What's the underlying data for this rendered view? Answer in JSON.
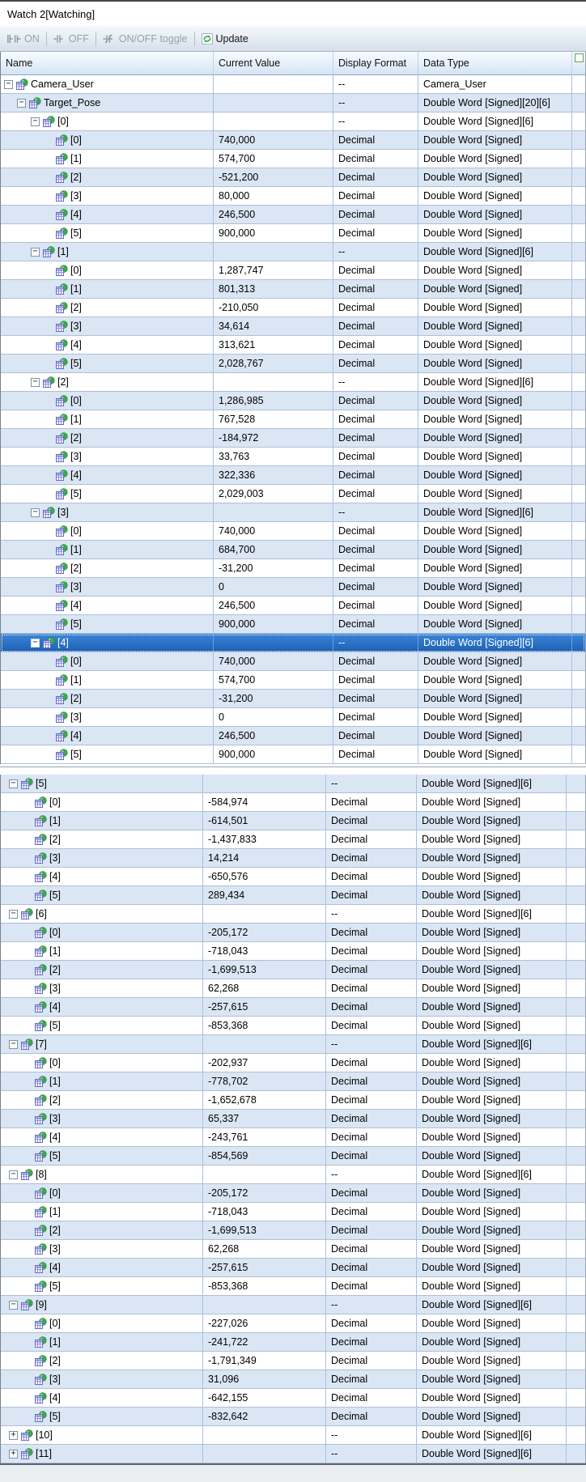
{
  "window": {
    "title": "Watch 2[Watching]"
  },
  "toolbar": {
    "items": [
      {
        "label": "ON",
        "icon": "contact-on-icon",
        "enabled": false
      },
      {
        "label": "OFF",
        "icon": "contact-off-icon",
        "enabled": false
      },
      {
        "label": "ON/OFF toggle",
        "icon": "contact-toggle-icon",
        "enabled": false
      },
      {
        "label": "Update",
        "icon": "refresh-icon",
        "enabled": true
      }
    ]
  },
  "columns": [
    "Name",
    "Current Value",
    "Display Format",
    "Data Type"
  ],
  "colors": {
    "selection_blue": "#2a6fc7",
    "row_alt_blue": "#dbe6f5",
    "grid_line_blue": "#a6c1e2",
    "refresh_green": "#2fa043"
  },
  "panes": [
    {
      "id": "top",
      "rows": [
        {
          "name": "Camera_User",
          "value": "",
          "format": "--",
          "dtype": "Camera_User",
          "indent": 0,
          "expander": "minus"
        },
        {
          "name": "Target_Pose",
          "value": "",
          "format": "--",
          "dtype": "Double Word [Signed][20][6]",
          "indent": 1,
          "expander": "minus"
        },
        {
          "name": "[0]",
          "value": "",
          "format": "--",
          "dtype": "Double Word [Signed][6]",
          "indent": 2,
          "expander": "minus"
        },
        {
          "name": "[0]",
          "value": "740,000",
          "format": "Decimal",
          "dtype": "Double Word [Signed]",
          "indent": 3
        },
        {
          "name": "[1]",
          "value": "574,700",
          "format": "Decimal",
          "dtype": "Double Word [Signed]",
          "indent": 3
        },
        {
          "name": "[2]",
          "value": "-521,200",
          "format": "Decimal",
          "dtype": "Double Word [Signed]",
          "indent": 3
        },
        {
          "name": "[3]",
          "value": "80,000",
          "format": "Decimal",
          "dtype": "Double Word [Signed]",
          "indent": 3
        },
        {
          "name": "[4]",
          "value": "246,500",
          "format": "Decimal",
          "dtype": "Double Word [Signed]",
          "indent": 3
        },
        {
          "name": "[5]",
          "value": "900,000",
          "format": "Decimal",
          "dtype": "Double Word [Signed]",
          "indent": 3
        },
        {
          "name": "[1]",
          "value": "",
          "format": "--",
          "dtype": "Double Word [Signed][6]",
          "indent": 2,
          "expander": "minus"
        },
        {
          "name": "[0]",
          "value": "1,287,747",
          "format": "Decimal",
          "dtype": "Double Word [Signed]",
          "indent": 3
        },
        {
          "name": "[1]",
          "value": "801,313",
          "format": "Decimal",
          "dtype": "Double Word [Signed]",
          "indent": 3
        },
        {
          "name": "[2]",
          "value": "-210,050",
          "format": "Decimal",
          "dtype": "Double Word [Signed]",
          "indent": 3
        },
        {
          "name": "[3]",
          "value": "34,614",
          "format": "Decimal",
          "dtype": "Double Word [Signed]",
          "indent": 3
        },
        {
          "name": "[4]",
          "value": "313,621",
          "format": "Decimal",
          "dtype": "Double Word [Signed]",
          "indent": 3
        },
        {
          "name": "[5]",
          "value": "2,028,767",
          "format": "Decimal",
          "dtype": "Double Word [Signed]",
          "indent": 3
        },
        {
          "name": "[2]",
          "value": "",
          "format": "--",
          "dtype": "Double Word [Signed][6]",
          "indent": 2,
          "expander": "minus"
        },
        {
          "name": "[0]",
          "value": "1,286,985",
          "format": "Decimal",
          "dtype": "Double Word [Signed]",
          "indent": 3
        },
        {
          "name": "[1]",
          "value": "767,528",
          "format": "Decimal",
          "dtype": "Double Word [Signed]",
          "indent": 3
        },
        {
          "name": "[2]",
          "value": "-184,972",
          "format": "Decimal",
          "dtype": "Double Word [Signed]",
          "indent": 3
        },
        {
          "name": "[3]",
          "value": "33,763",
          "format": "Decimal",
          "dtype": "Double Word [Signed]",
          "indent": 3
        },
        {
          "name": "[4]",
          "value": "322,336",
          "format": "Decimal",
          "dtype": "Double Word [Signed]",
          "indent": 3
        },
        {
          "name": "[5]",
          "value": "2,029,003",
          "format": "Decimal",
          "dtype": "Double Word [Signed]",
          "indent": 3
        },
        {
          "name": "[3]",
          "value": "",
          "format": "--",
          "dtype": "Double Word [Signed][6]",
          "indent": 2,
          "expander": "minus"
        },
        {
          "name": "[0]",
          "value": "740,000",
          "format": "Decimal",
          "dtype": "Double Word [Signed]",
          "indent": 3
        },
        {
          "name": "[1]",
          "value": "684,700",
          "format": "Decimal",
          "dtype": "Double Word [Signed]",
          "indent": 3
        },
        {
          "name": "[2]",
          "value": "-31,200",
          "format": "Decimal",
          "dtype": "Double Word [Signed]",
          "indent": 3
        },
        {
          "name": "[3]",
          "value": "0",
          "format": "Decimal",
          "dtype": "Double Word [Signed]",
          "indent": 3
        },
        {
          "name": "[4]",
          "value": "246,500",
          "format": "Decimal",
          "dtype": "Double Word [Signed]",
          "indent": 3
        },
        {
          "name": "[5]",
          "value": "900,000",
          "format": "Decimal",
          "dtype": "Double Word [Signed]",
          "indent": 3
        },
        {
          "name": "[4]",
          "value": "",
          "format": "--",
          "dtype": "Double Word [Signed][6]",
          "indent": 2,
          "expander": "minus",
          "selected": true
        },
        {
          "name": "[0]",
          "value": "740,000",
          "format": "Decimal",
          "dtype": "Double Word [Signed]",
          "indent": 3
        },
        {
          "name": "[1]",
          "value": "574,700",
          "format": "Decimal",
          "dtype": "Double Word [Signed]",
          "indent": 3
        },
        {
          "name": "[2]",
          "value": "-31,200",
          "format": "Decimal",
          "dtype": "Double Word [Signed]",
          "indent": 3
        },
        {
          "name": "[3]",
          "value": "0",
          "format": "Decimal",
          "dtype": "Double Word [Signed]",
          "indent": 3
        },
        {
          "name": "[4]",
          "value": "246,500",
          "format": "Decimal",
          "dtype": "Double Word [Signed]",
          "indent": 3
        },
        {
          "name": "[5]",
          "value": "900,000",
          "format": "Decimal",
          "dtype": "Double Word [Signed]",
          "indent": 3
        }
      ]
    },
    {
      "id": "bottom",
      "rows": [
        {
          "name": "[5]",
          "value": "",
          "format": "--",
          "dtype": "Double Word [Signed][6]",
          "indent": 2,
          "expander": "minus"
        },
        {
          "name": "[0]",
          "value": "-584,974",
          "format": "Decimal",
          "dtype": "Double Word [Signed]",
          "indent": 3
        },
        {
          "name": "[1]",
          "value": "-614,501",
          "format": "Decimal",
          "dtype": "Double Word [Signed]",
          "indent": 3
        },
        {
          "name": "[2]",
          "value": "-1,437,833",
          "format": "Decimal",
          "dtype": "Double Word [Signed]",
          "indent": 3
        },
        {
          "name": "[3]",
          "value": "14,214",
          "format": "Decimal",
          "dtype": "Double Word [Signed]",
          "indent": 3
        },
        {
          "name": "[4]",
          "value": "-650,576",
          "format": "Decimal",
          "dtype": "Double Word [Signed]",
          "indent": 3
        },
        {
          "name": "[5]",
          "value": "289,434",
          "format": "Decimal",
          "dtype": "Double Word [Signed]",
          "indent": 3
        },
        {
          "name": "[6]",
          "value": "",
          "format": "--",
          "dtype": "Double Word [Signed][6]",
          "indent": 2,
          "expander": "minus"
        },
        {
          "name": "[0]",
          "value": "-205,172",
          "format": "Decimal",
          "dtype": "Double Word [Signed]",
          "indent": 3
        },
        {
          "name": "[1]",
          "value": "-718,043",
          "format": "Decimal",
          "dtype": "Double Word [Signed]",
          "indent": 3
        },
        {
          "name": "[2]",
          "value": "-1,699,513",
          "format": "Decimal",
          "dtype": "Double Word [Signed]",
          "indent": 3
        },
        {
          "name": "[3]",
          "value": "62,268",
          "format": "Decimal",
          "dtype": "Double Word [Signed]",
          "indent": 3
        },
        {
          "name": "[4]",
          "value": "-257,615",
          "format": "Decimal",
          "dtype": "Double Word [Signed]",
          "indent": 3
        },
        {
          "name": "[5]",
          "value": "-853,368",
          "format": "Decimal",
          "dtype": "Double Word [Signed]",
          "indent": 3
        },
        {
          "name": "[7]",
          "value": "",
          "format": "--",
          "dtype": "Double Word [Signed][6]",
          "indent": 2,
          "expander": "minus"
        },
        {
          "name": "[0]",
          "value": "-202,937",
          "format": "Decimal",
          "dtype": "Double Word [Signed]",
          "indent": 3
        },
        {
          "name": "[1]",
          "value": "-778,702",
          "format": "Decimal",
          "dtype": "Double Word [Signed]",
          "indent": 3
        },
        {
          "name": "[2]",
          "value": "-1,652,678",
          "format": "Decimal",
          "dtype": "Double Word [Signed]",
          "indent": 3
        },
        {
          "name": "[3]",
          "value": "65,337",
          "format": "Decimal",
          "dtype": "Double Word [Signed]",
          "indent": 3
        },
        {
          "name": "[4]",
          "value": "-243,761",
          "format": "Decimal",
          "dtype": "Double Word [Signed]",
          "indent": 3
        },
        {
          "name": "[5]",
          "value": "-854,569",
          "format": "Decimal",
          "dtype": "Double Word [Signed]",
          "indent": 3
        },
        {
          "name": "[8]",
          "value": "",
          "format": "--",
          "dtype": "Double Word [Signed][6]",
          "indent": 2,
          "expander": "minus"
        },
        {
          "name": "[0]",
          "value": "-205,172",
          "format": "Decimal",
          "dtype": "Double Word [Signed]",
          "indent": 3
        },
        {
          "name": "[1]",
          "value": "-718,043",
          "format": "Decimal",
          "dtype": "Double Word [Signed]",
          "indent": 3
        },
        {
          "name": "[2]",
          "value": "-1,699,513",
          "format": "Decimal",
          "dtype": "Double Word [Signed]",
          "indent": 3
        },
        {
          "name": "[3]",
          "value": "62,268",
          "format": "Decimal",
          "dtype": "Double Word [Signed]",
          "indent": 3
        },
        {
          "name": "[4]",
          "value": "-257,615",
          "format": "Decimal",
          "dtype": "Double Word [Signed]",
          "indent": 3
        },
        {
          "name": "[5]",
          "value": "-853,368",
          "format": "Decimal",
          "dtype": "Double Word [Signed]",
          "indent": 3
        },
        {
          "name": "[9]",
          "value": "",
          "format": "--",
          "dtype": "Double Word [Signed][6]",
          "indent": 2,
          "expander": "minus"
        },
        {
          "name": "[0]",
          "value": "-227,026",
          "format": "Decimal",
          "dtype": "Double Word [Signed]",
          "indent": 3
        },
        {
          "name": "[1]",
          "value": "-241,722",
          "format": "Decimal",
          "dtype": "Double Word [Signed]",
          "indent": 3
        },
        {
          "name": "[2]",
          "value": "-1,791,349",
          "format": "Decimal",
          "dtype": "Double Word [Signed]",
          "indent": 3
        },
        {
          "name": "[3]",
          "value": "31,096",
          "format": "Decimal",
          "dtype": "Double Word [Signed]",
          "indent": 3
        },
        {
          "name": "[4]",
          "value": "-642,155",
          "format": "Decimal",
          "dtype": "Double Word [Signed]",
          "indent": 3
        },
        {
          "name": "[5]",
          "value": "-832,642",
          "format": "Decimal",
          "dtype": "Double Word [Signed]",
          "indent": 3
        },
        {
          "name": "[10]",
          "value": "",
          "format": "--",
          "dtype": "Double Word [Signed][6]",
          "indent": 2,
          "expander": "plus"
        },
        {
          "name": "[11]",
          "value": "",
          "format": "--",
          "dtype": "Double Word [Signed][6]",
          "indent": 2,
          "expander": "plus"
        }
      ]
    }
  ]
}
